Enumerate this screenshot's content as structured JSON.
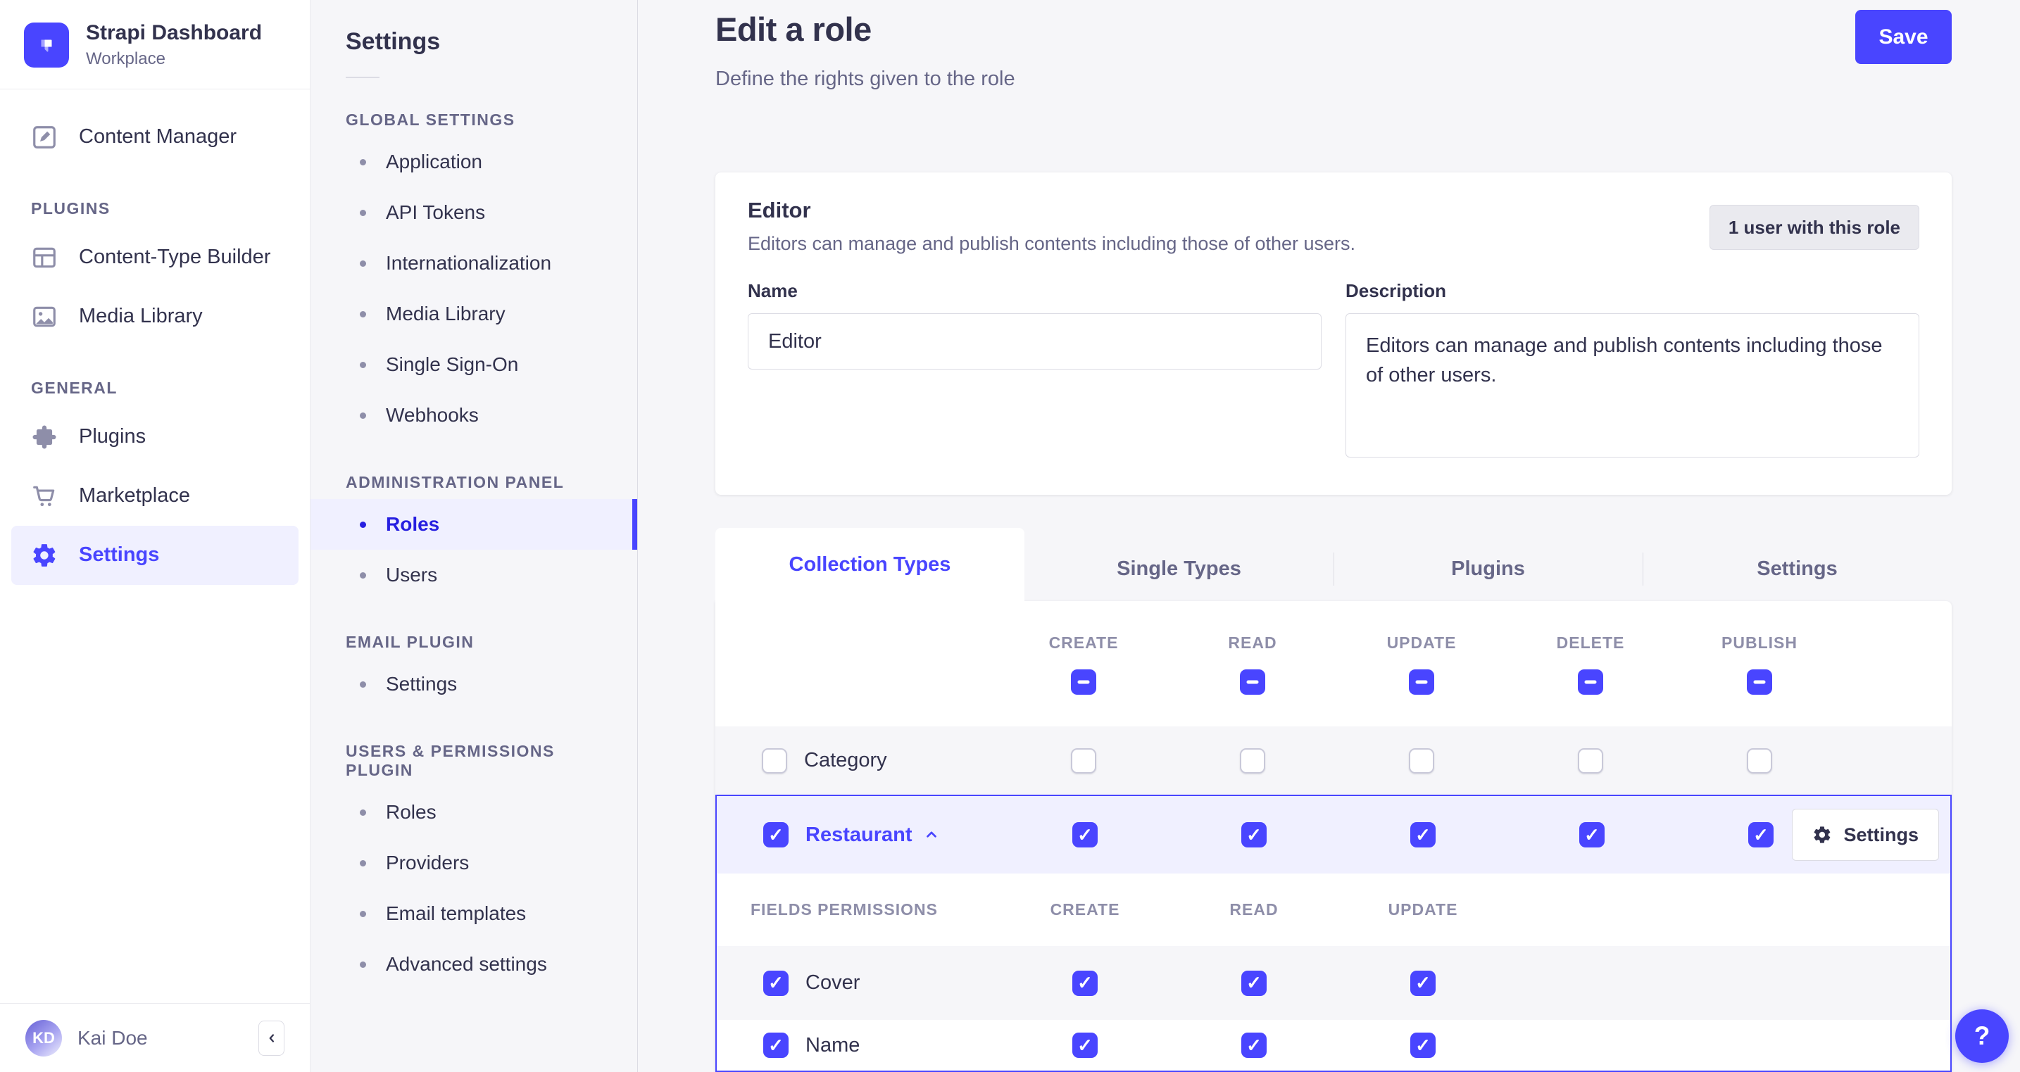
{
  "sidebar": {
    "brand": {
      "title": "Strapi Dashboard",
      "subtitle": "Workplace"
    },
    "top_item": "Content Manager",
    "sections": [
      {
        "heading": "PLUGINS",
        "items": [
          "Content-Type Builder",
          "Media Library"
        ]
      },
      {
        "heading": "GENERAL",
        "items": [
          "Plugins",
          "Marketplace",
          "Settings"
        ]
      }
    ],
    "user": {
      "initials": "KD",
      "name": "Kai Doe"
    }
  },
  "subnav": {
    "title": "Settings",
    "sections": [
      {
        "heading": "GLOBAL SETTINGS",
        "items": [
          "Application",
          "API Tokens",
          "Internationalization",
          "Media Library",
          "Single Sign-On",
          "Webhooks"
        ]
      },
      {
        "heading": "ADMINISTRATION PANEL",
        "items": [
          "Roles",
          "Users"
        ],
        "active_item": "Roles"
      },
      {
        "heading": "EMAIL PLUGIN",
        "items": [
          "Settings"
        ]
      },
      {
        "heading": "USERS & PERMISSIONS PLUGIN",
        "items": [
          "Roles",
          "Providers",
          "Email templates",
          "Advanced settings"
        ]
      }
    ]
  },
  "header": {
    "title": "Edit a role",
    "subtitle": "Define the rights given to the role",
    "save_label": "Save"
  },
  "role_card": {
    "title": "Editor",
    "subtitle": "Editors can manage and publish contents including those of other users.",
    "users_badge": "1 user with this role",
    "name_label": "Name",
    "name_value": "Editor",
    "description_label": "Description",
    "description_value": "Editors can manage and publish contents including those of other users."
  },
  "permissions": {
    "tabs": [
      "Collection Types",
      "Single Types",
      "Plugins",
      "Settings"
    ],
    "active_tab": "Collection Types",
    "columns": [
      "CREATE",
      "READ",
      "UPDATE",
      "DELETE",
      "PUBLISH"
    ],
    "header_checkbox_state": "indeterminate",
    "rows": [
      {
        "label": "Category",
        "checked": false,
        "create": false,
        "read": false,
        "update": false,
        "delete": false,
        "publish": false,
        "expanded": false
      },
      {
        "label": "Restaurant",
        "checked": true,
        "create": true,
        "read": true,
        "update": true,
        "delete": true,
        "publish": true,
        "expanded": true,
        "settings_label": "Settings"
      }
    ],
    "fields": {
      "heading": "FIELDS PERMISSIONS",
      "columns": [
        "CREATE",
        "READ",
        "UPDATE"
      ],
      "rows": [
        {
          "label": "Cover",
          "checked": true,
          "create": true,
          "read": true,
          "update": true
        },
        {
          "label": "Name",
          "checked": true,
          "create": true,
          "read": true,
          "update": true
        }
      ]
    }
  },
  "colors": {
    "primary": "#4945ff",
    "active_link": "#271fe0",
    "active_bg": "#f0f0ff",
    "page_bg": "#f6f6f9",
    "text_dark": "#32324d",
    "text_gray": "#666687",
    "text_light": "#8e8ea9",
    "border": "#dcdce4"
  },
  "help_label": "?"
}
